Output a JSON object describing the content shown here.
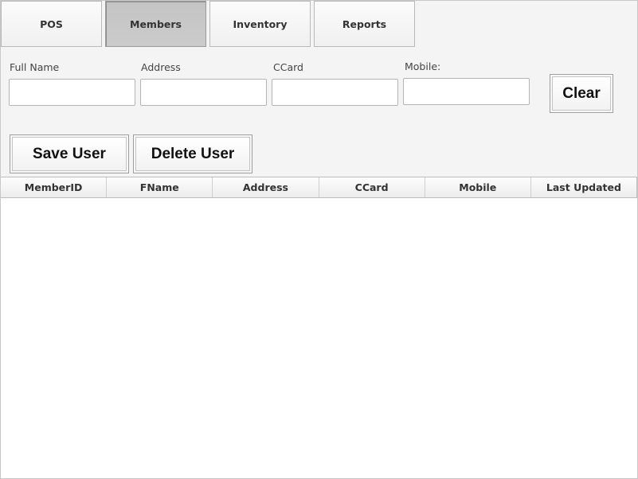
{
  "tabs": [
    {
      "label": "POS"
    },
    {
      "label": "Members"
    },
    {
      "label": "Inventory"
    },
    {
      "label": "Reports"
    }
  ],
  "active_tab": "Members",
  "form": {
    "full_name": {
      "label": "Full Name",
      "value": ""
    },
    "address": {
      "label": "Address",
      "value": ""
    },
    "ccard": {
      "label": "CCard",
      "value": ""
    },
    "mobile": {
      "label": "Mobile:",
      "value": ""
    }
  },
  "buttons": {
    "clear": "Clear",
    "save_user": "Save User",
    "delete_user": "Delete User"
  },
  "table": {
    "columns": [
      "MemberID",
      "FName",
      "Address",
      "CCard",
      "Mobile",
      "Last Updated"
    ],
    "rows": []
  }
}
